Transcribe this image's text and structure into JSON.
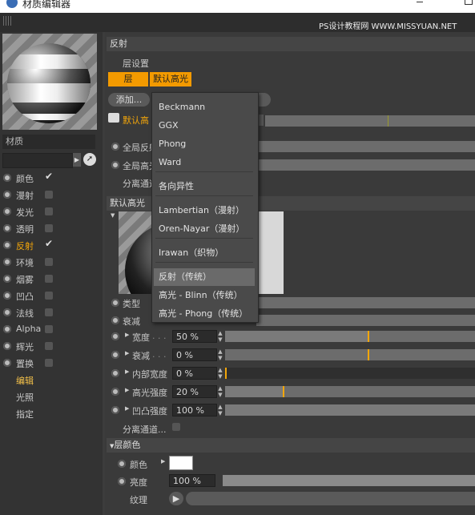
{
  "window": {
    "title": "材质编辑器",
    "watermark": "PS设计教程网  WWW.MISSYUAN.NET"
  },
  "material_name_label": "材质",
  "channels": [
    {
      "label": "颜色",
      "checked": true,
      "active": false
    },
    {
      "label": "漫射",
      "checked": false,
      "active": false
    },
    {
      "label": "发光",
      "checked": false,
      "active": false
    },
    {
      "label": "透明",
      "checked": false,
      "active": false
    },
    {
      "label": "反射",
      "checked": true,
      "active": true
    },
    {
      "label": "环境",
      "checked": false,
      "active": false
    },
    {
      "label": "烟雾",
      "checked": false,
      "active": false
    },
    {
      "label": "凹凸",
      "checked": false,
      "active": false
    },
    {
      "label": "法线",
      "checked": false,
      "active": false
    },
    {
      "label": "Alpha",
      "checked": false,
      "active": false
    },
    {
      "label": "辉光",
      "checked": false,
      "active": false
    },
    {
      "label": "置换",
      "checked": false,
      "active": false
    }
  ],
  "subitems": [
    "编辑",
    "光照",
    "指定"
  ],
  "reflect": {
    "header": "反射",
    "layer_settings": "层设置",
    "tab_layer": "层",
    "tab_default": "默认高光",
    "add_button": "添加...",
    "layer_row_label": "默认高",
    "global_reflect": "全局反射",
    "global_highlight": "全局高光",
    "separate_pass": "分离通道"
  },
  "default_highlight": {
    "header": "默认高光",
    "type_label": "类型",
    "attenuation_label": "衰减",
    "rows": [
      {
        "label": "宽度",
        "value": "50 %",
        "level": 0.5
      },
      {
        "label": "衰减",
        "value": "0 %",
        "level": 0.5
      },
      {
        "label": "内部宽度",
        "value": "0 %",
        "level": 0.0
      },
      {
        "label": "高光强度",
        "value": "20 %",
        "level": 0.2
      },
      {
        "label": "凹凸强度",
        "value": "100 %",
        "level": 1.0
      }
    ],
    "separate_pass": "分离通道..."
  },
  "layer_color": {
    "header": "层颜色",
    "color_label": "颜色",
    "brightness_label": "亮度",
    "brightness_value": "100 %",
    "texture_label": "纹理"
  },
  "dropdown": {
    "items": [
      {
        "label": "Beckmann",
        "selected": false
      },
      {
        "label": "GGX",
        "selected": false
      },
      {
        "label": "Phong",
        "selected": false
      },
      {
        "label": "Ward",
        "selected": false
      },
      {
        "label": "各向异性",
        "selected": false
      },
      {
        "label": "Lambertian（漫射）",
        "selected": false
      },
      {
        "label": "Oren-Nayar（漫射）",
        "selected": false
      },
      {
        "label": "Irawan（织物）",
        "selected": false
      },
      {
        "label": "反射（传统）",
        "selected": true
      },
      {
        "label": "高光 - Blinn（传统）",
        "selected": false
      },
      {
        "label": "高光 - Phong（传统）",
        "selected": false
      }
    ]
  },
  "colors": {
    "accent": "#f39a00",
    "panel": "#3a3a3a",
    "menu": "#4a4a4a"
  }
}
